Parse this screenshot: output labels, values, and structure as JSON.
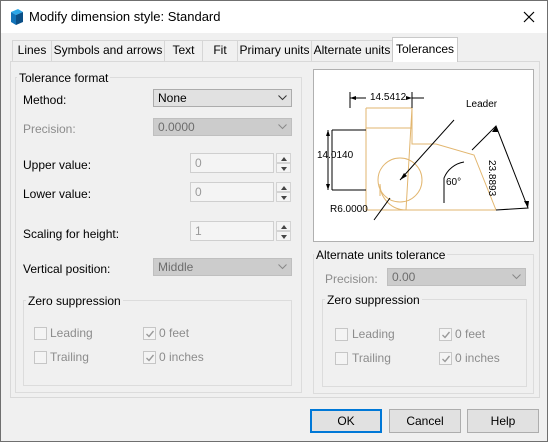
{
  "window": {
    "title": "Modify dimension style: Standard"
  },
  "tabs": [
    {
      "label": "Lines"
    },
    {
      "label": "Symbols and arrows"
    },
    {
      "label": "Text"
    },
    {
      "label": "Fit"
    },
    {
      "label": "Primary units"
    },
    {
      "label": "Alternate units"
    },
    {
      "label": "Tolerances"
    }
  ],
  "active_tab": "Tolerances",
  "tolerance_format": {
    "group_label": "Tolerance format",
    "method_label": "Method:",
    "method_value": "None",
    "precision_label": "Precision:",
    "precision_value": "0.0000",
    "upper_label": "Upper value:",
    "upper_value": "0",
    "lower_label": "Lower value:",
    "lower_value": "0",
    "scaling_label": "Scaling for height:",
    "scaling_value": "1",
    "vertical_label": "Vertical position:",
    "vertical_value": "Middle",
    "zero_suppression": {
      "label": "Zero suppression",
      "leading": "Leading",
      "trailing": "Trailing",
      "feet": "0 feet",
      "inches": "0 inches"
    }
  },
  "preview": {
    "dim_top": "14.5412",
    "dim_left": "14.0140",
    "dim_diag": "23.8893",
    "angle": "60°",
    "radius": "R6.0000",
    "leader": "Leader"
  },
  "alternate_units_tolerance": {
    "group_label": "Alternate units tolerance",
    "precision_label": "Precision:",
    "precision_value": "0.00",
    "zero_suppression": {
      "label": "Zero suppression",
      "leading": "Leading",
      "trailing": "Trailing",
      "feet": "0 feet",
      "inches": "0 inches"
    }
  },
  "buttons": {
    "ok": "OK",
    "cancel": "Cancel",
    "help": "Help"
  },
  "colors": {
    "accent": "#0078d7",
    "preview_line": "#e2b66f",
    "app_icon": "#1e88c9"
  }
}
